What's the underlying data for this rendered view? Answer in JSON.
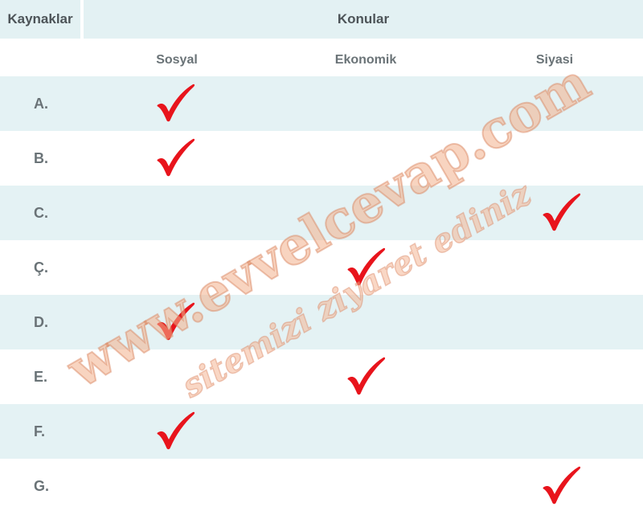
{
  "header": {
    "sources_label": "Kaynaklar",
    "topics_label": "Konular",
    "columns": [
      "Sosyal",
      "Ekonomik",
      "Siyasi"
    ]
  },
  "rows": [
    {
      "label": "A.",
      "checks": [
        "Sosyal"
      ]
    },
    {
      "label": "B.",
      "checks": [
        "Sosyal"
      ]
    },
    {
      "label": "C.",
      "checks": [
        "Siyasi"
      ]
    },
    {
      "label": "Ç.",
      "checks": [
        "Ekonomik"
      ]
    },
    {
      "label": "D.",
      "checks": [
        "Sosyal"
      ]
    },
    {
      "label": "E.",
      "checks": [
        "Ekonomik"
      ]
    },
    {
      "label": "F.",
      "checks": [
        "Sosyal"
      ]
    },
    {
      "label": "G.",
      "checks": [
        "Siyasi"
      ]
    }
  ],
  "watermark": {
    "line1": "www.evvelcevap.com",
    "line2": "sitemizi ziyaret ediniz"
  },
  "colors": {
    "check": "#e8141c",
    "header_bg": "#e3f1f3",
    "watermark": "#f3b08c"
  },
  "icons": {
    "check": "checkmark-icon"
  }
}
